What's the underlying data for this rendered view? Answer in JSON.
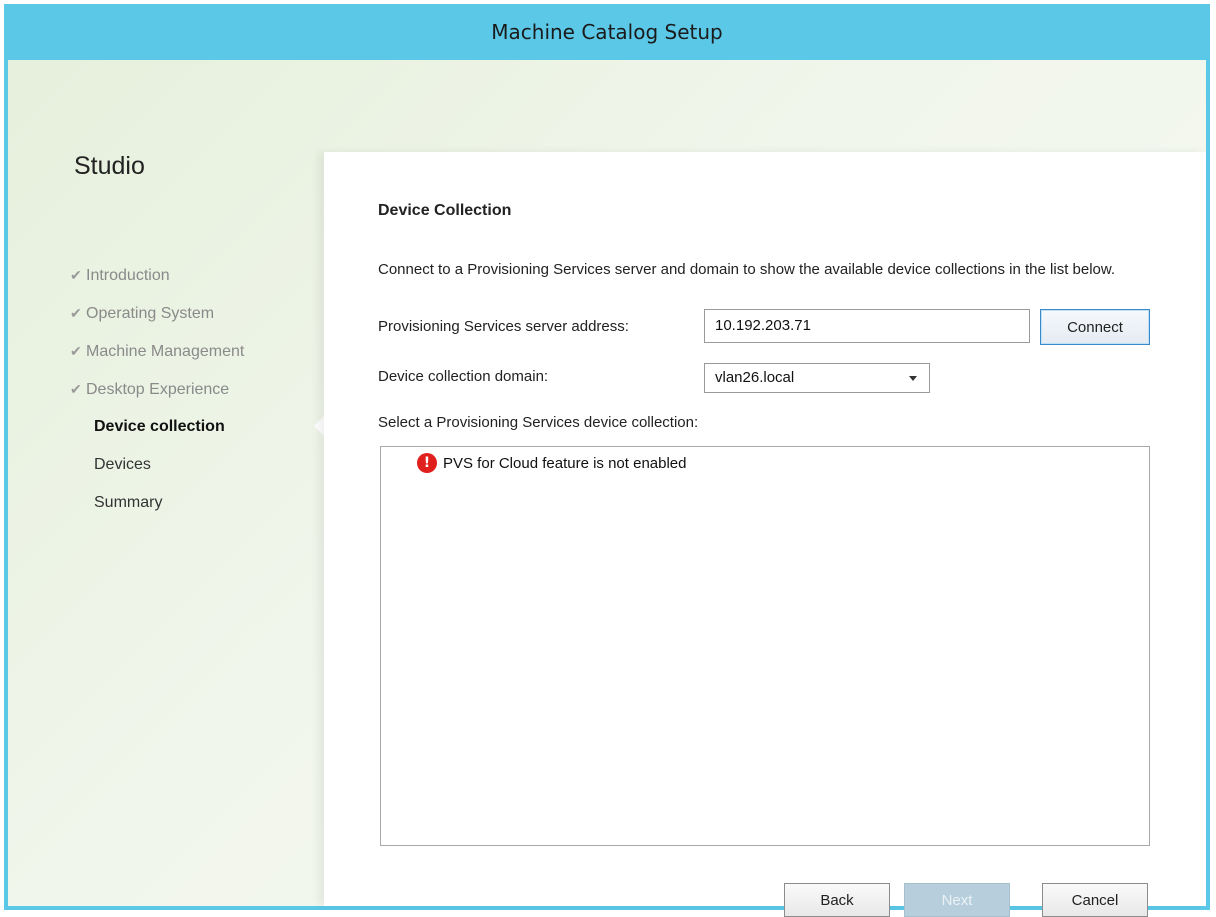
{
  "window": {
    "title": "Machine Catalog Setup"
  },
  "sidebar": {
    "title": "Studio",
    "items": [
      {
        "label": "Introduction",
        "state": "done"
      },
      {
        "label": "Operating System",
        "state": "done"
      },
      {
        "label": "Machine Management",
        "state": "done"
      },
      {
        "label": "Desktop Experience",
        "state": "done"
      },
      {
        "label": "Device collection",
        "state": "current"
      },
      {
        "label": "Devices",
        "state": "pending"
      },
      {
        "label": "Summary",
        "state": "pending"
      }
    ]
  },
  "main": {
    "heading": "Device Collection",
    "description": "Connect to a Provisioning Services server and domain to show the available device collections in the list below.",
    "server_label": "Provisioning Services server address:",
    "server_value": "10.192.203.71",
    "connect_label": "Connect",
    "domain_label": "Device collection domain:",
    "domain_value": "vlan26.local",
    "collection_label": "Select a Provisioning Services device collection:",
    "error_message": "PVS for Cloud feature is not enabled",
    "error_glyph": "!"
  },
  "footer": {
    "back_label": "Back",
    "next_label": "Next",
    "cancel_label": "Cancel"
  },
  "colors": {
    "titlebar": "#5bc8e8",
    "error": "#e0201c",
    "connect_border": "#3a8ac9"
  }
}
